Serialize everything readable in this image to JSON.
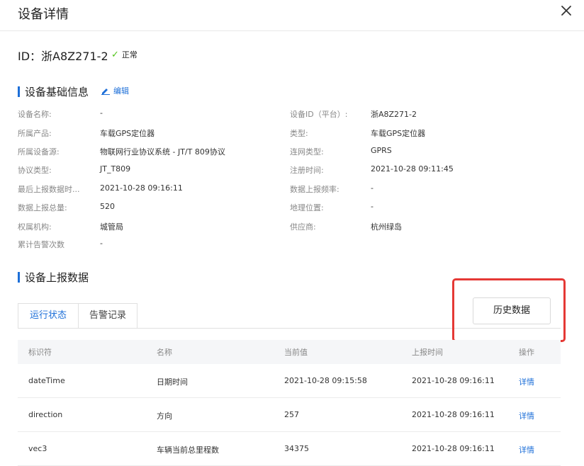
{
  "header": {
    "title": "设备详情"
  },
  "device": {
    "id": "ID：浙A8Z271-2",
    "status": "正常"
  },
  "basic_info": {
    "title": "设备基础信息",
    "edit_label": "编辑",
    "left": [
      {
        "label": "设备名称:",
        "value": "-"
      },
      {
        "label": "所属产品:",
        "value": "车载GPS定位器"
      },
      {
        "label": "所属设备源:",
        "value": "物联网行业协议系统 - JT/T 809协议"
      },
      {
        "label": "协议类型:",
        "value": "JT_T809"
      },
      {
        "label": "最后上报数据时...",
        "value": "2021-10-28 09:16:11"
      },
      {
        "label": "数据上报总量:",
        "value": "520"
      },
      {
        "label": "权属机构:",
        "value": "城管局"
      },
      {
        "label": "累计告警次数",
        "value": "-"
      }
    ],
    "right": [
      {
        "label": "设备ID（平台）:",
        "value": "浙A8Z271-2"
      },
      {
        "label": "类型:",
        "value": "车载GPS定位器"
      },
      {
        "label": "连网类型:",
        "value": "GPRS"
      },
      {
        "label": "注册时间:",
        "value": "2021-10-28 09:11:45"
      },
      {
        "label": "数据上报频率:",
        "value": "-"
      },
      {
        "label": "地理位置:",
        "value": "-"
      },
      {
        "label": "供应商:",
        "value": "杭州绿岛"
      }
    ]
  },
  "report": {
    "title": "设备上报数据",
    "tabs": [
      {
        "label": "运行状态"
      },
      {
        "label": "告警记录"
      }
    ],
    "history_button": "历史数据",
    "columns": [
      "标识符",
      "名称",
      "当前值",
      "上报时间",
      "操作"
    ],
    "rows": [
      {
        "id": "dateTime",
        "name": "日期时间",
        "value": "2021-10-28 09:15:58",
        "time": "2021-10-28 09:16:11",
        "action": "详情"
      },
      {
        "id": "direction",
        "name": "方向",
        "value": "257",
        "time": "2021-10-28 09:16:11",
        "action": "详情"
      },
      {
        "id": "vec3",
        "name": "车辆当前总里程数",
        "value": "34375",
        "time": "2021-10-28 09:16:11",
        "action": "详情"
      }
    ]
  },
  "colors": {
    "accent": "#1d6fd8",
    "success": "#52c41a",
    "highlight": "#e53935"
  },
  "icons": {
    "close": "close-icon",
    "edit": "pencil-icon",
    "status": "check-icon"
  }
}
